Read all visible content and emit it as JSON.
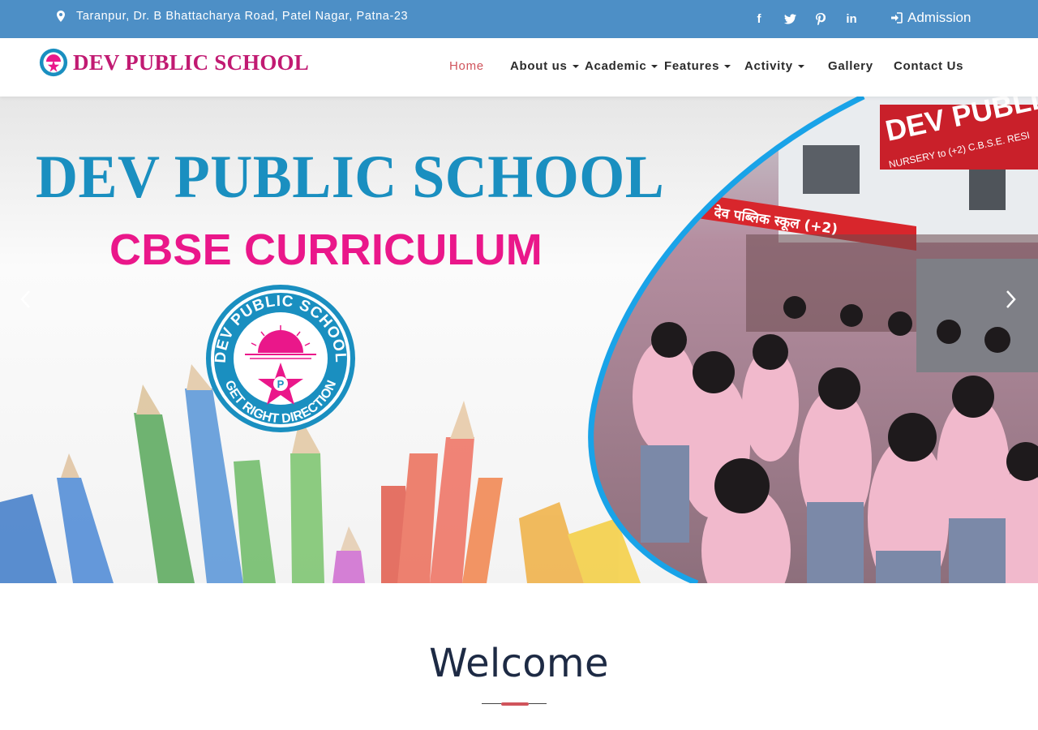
{
  "topbar": {
    "address": "Taranpur, Dr. B Bhattacharya Road, Patel Nagar, Patna-23",
    "address_icon": "map-marker-icon",
    "social": [
      {
        "name": "facebook-icon",
        "glyph": "f"
      },
      {
        "name": "twitter-icon",
        "glyph": "t"
      },
      {
        "name": "pinterest-icon",
        "glyph": "p"
      },
      {
        "name": "linkedin-icon",
        "glyph": "in"
      }
    ],
    "admission_label": "Admission",
    "admission_icon": "sign-in-icon",
    "bg_color": "#4d8fc6"
  },
  "navbar": {
    "logo_text": "DEV PUBLIC SCHOOL",
    "items": [
      {
        "label": "Home",
        "active": true,
        "dropdown": false
      },
      {
        "label": "About us",
        "active": false,
        "dropdown": true
      },
      {
        "label": "Academic",
        "active": false,
        "dropdown": true
      },
      {
        "label": "Features",
        "active": false,
        "dropdown": true
      },
      {
        "label": "Activity",
        "active": false,
        "dropdown": true
      },
      {
        "label": "Gallery",
        "active": false,
        "dropdown": false
      },
      {
        "label": "Contact Us",
        "active": false,
        "dropdown": false
      }
    ],
    "active_color": "#d0545c"
  },
  "hero": {
    "title": "DEV PUBLIC SCHOOL",
    "subtitle": "CBSE CURRICULUM",
    "emblem_top_text": "DEV PUBLIC SCHOOL",
    "emblem_bottom_text": "GET RIGHT DIRECTION",
    "emblem_center": "P",
    "photo_sign_text": "देव पब्लिक स्कूल (+2)",
    "photo_banner_text": "DEV PUBLIC S",
    "photo_banner_sub": "NURSERY to (+2) C.B.S.E. RESI",
    "title_color": "#1a8fc0",
    "subtitle_color": "#ea178a"
  },
  "welcome": {
    "heading": "Welcome",
    "accent_color": "#d0545c"
  }
}
